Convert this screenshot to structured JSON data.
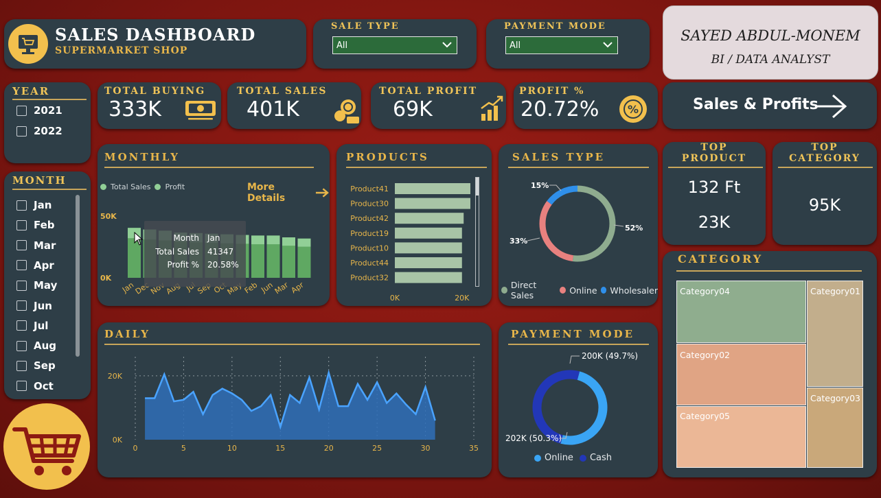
{
  "header": {
    "title": "SALES DASHBOARD",
    "subtitle": "SUPERMARKET SHOP"
  },
  "filters": {
    "sale_type": {
      "label": "SALE TYPE",
      "value": "All"
    },
    "payment_mode": {
      "label": "PAYMENT MODE",
      "value": "All"
    }
  },
  "author": {
    "name": "SAYED ABDUL-MONEM",
    "role": "BI / DATA ANALYST"
  },
  "kpis": [
    {
      "title": "TOTAL BUYING",
      "value": "333K"
    },
    {
      "title": "TOTAL SALES",
      "value": "401K"
    },
    {
      "title": "TOTAL PROFIT",
      "value": "69K"
    },
    {
      "title": "PROFIT %",
      "value": "20.72%"
    }
  ],
  "nav": {
    "label": "Sales & Profits"
  },
  "year": {
    "title": "YEAR",
    "options": [
      "2021",
      "2022"
    ]
  },
  "month": {
    "title": "MONTH",
    "options": [
      "Jan",
      "Feb",
      "Mar",
      "Apr",
      "May",
      "Jun",
      "Jul",
      "Aug",
      "Sep",
      "Oct"
    ]
  },
  "monthly": {
    "title": "MONTHLY",
    "more": "More Details",
    "legend": [
      "Total Sales",
      "Profit"
    ],
    "tooltip": {
      "rows": [
        [
          "Month",
          "Jan"
        ],
        [
          "Total Sales",
          "41347"
        ],
        [
          "Profit %",
          "20.58%"
        ]
      ]
    }
  },
  "products": {
    "title": "PRODUCTS"
  },
  "sales_type": {
    "title": "SALES TYPE"
  },
  "top_product": {
    "title": "TOP PRODUCT",
    "name": "132 Ft",
    "value": "23K"
  },
  "top_category": {
    "title": "TOP CATEGORY",
    "value": "95K"
  },
  "category": {
    "title": "CATEGORY",
    "items": [
      "Category04",
      "Category01",
      "Category02",
      "Category03",
      "Category05"
    ],
    "colors": [
      "#8fad8e",
      "#c2ae8c",
      "#e0a484",
      "#c9a87a",
      "#ebb796"
    ]
  },
  "daily": {
    "title": "DAILY"
  },
  "payment": {
    "title": "PAYMENT MODE"
  },
  "chart_data": [
    {
      "type": "bar",
      "title": "MONTHLY",
      "categories": [
        "Jan",
        "Dec",
        "Nov",
        "Aug",
        "Jul",
        "Sep",
        "Oct",
        "May",
        "Feb",
        "Jun",
        "Mar",
        "Apr"
      ],
      "series": [
        {
          "name": "Total Sales",
          "values": [
            41347,
            40000,
            39000,
            37500,
            37000,
            36500,
            36000,
            35500,
            35000,
            35000,
            33500,
            32500
          ]
        },
        {
          "name": "Profit",
          "values": [
            8508,
            8200,
            8000,
            7700,
            7600,
            7500,
            7400,
            7300,
            7200,
            7200,
            6900,
            6700
          ]
        }
      ],
      "ytick_labels": [
        "0K",
        "50K"
      ],
      "ylim": [
        0,
        50000
      ],
      "colors": [
        "#91cf96",
        "#5fa862"
      ]
    },
    {
      "type": "bar",
      "title": "PRODUCTS",
      "orientation": "horizontal",
      "categories": [
        "Product41",
        "Product30",
        "Product42",
        "Product19",
        "Product10",
        "Product44",
        "Product32"
      ],
      "values": [
        22500,
        22500,
        20500,
        20000,
        20000,
        20000,
        20000
      ],
      "xtick_labels": [
        "0K",
        "20K"
      ],
      "xlim": [
        0,
        27000
      ],
      "color": "#a8c4a6"
    },
    {
      "type": "pie",
      "title": "SALES TYPE",
      "donut": true,
      "labels": [
        "Direct Sales",
        "Online",
        "Wholesaler"
      ],
      "values": [
        52,
        33,
        15
      ],
      "value_labels": [
        "52%",
        "33%",
        "15%"
      ],
      "colors": [
        "#8fac8f",
        "#e8817f",
        "#2f8fea"
      ]
    },
    {
      "type": "area",
      "title": "DAILY",
      "x": [
        1,
        2,
        3,
        4,
        5,
        6,
        7,
        8,
        9,
        10,
        11,
        12,
        13,
        14,
        15,
        16,
        17,
        18,
        19,
        20,
        21,
        22,
        23,
        24,
        25,
        26,
        27,
        28,
        29,
        30,
        31
      ],
      "y": [
        13000,
        13000,
        20500,
        12000,
        12500,
        15000,
        8000,
        14000,
        16000,
        14500,
        12500,
        9000,
        10500,
        14000,
        4000,
        14000,
        11500,
        19500,
        9500,
        21000,
        10500,
        10500,
        17500,
        12500,
        18000,
        11500,
        14500,
        11000,
        8000,
        16500,
        6000
      ],
      "xticks": [
        0,
        5,
        10,
        15,
        20,
        25,
        30,
        35
      ],
      "ytick_labels": [
        "0K",
        "20K"
      ],
      "xlim": [
        0,
        35
      ],
      "ylim": [
        0,
        26000
      ],
      "color": "#3f86d6"
    },
    {
      "type": "pie",
      "title": "PAYMENT MODE",
      "donut": true,
      "labels": [
        "Online",
        "Cash"
      ],
      "values": [
        200,
        202
      ],
      "value_labels": [
        "200K (49.7%)",
        "202K (50.3%)"
      ],
      "colors": [
        "#3aa5f5",
        "#2237b8"
      ]
    }
  ]
}
